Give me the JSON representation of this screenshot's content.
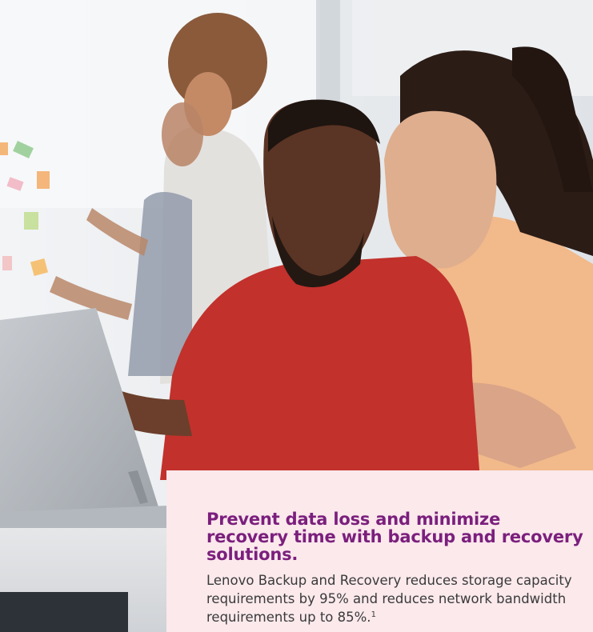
{
  "card": {
    "title": "Prevent data loss and minimize recovery time with backup and recovery solutions.",
    "body": "Lenovo Backup and Recovery reduces storage capacity requirements by 95% and reduces network bandwidth requirements up to 85%.",
    "footnote": "1"
  },
  "colors": {
    "title": "#7b1f7d",
    "card_background": "#fbe9ec",
    "body_text": "#3a3a3a"
  }
}
